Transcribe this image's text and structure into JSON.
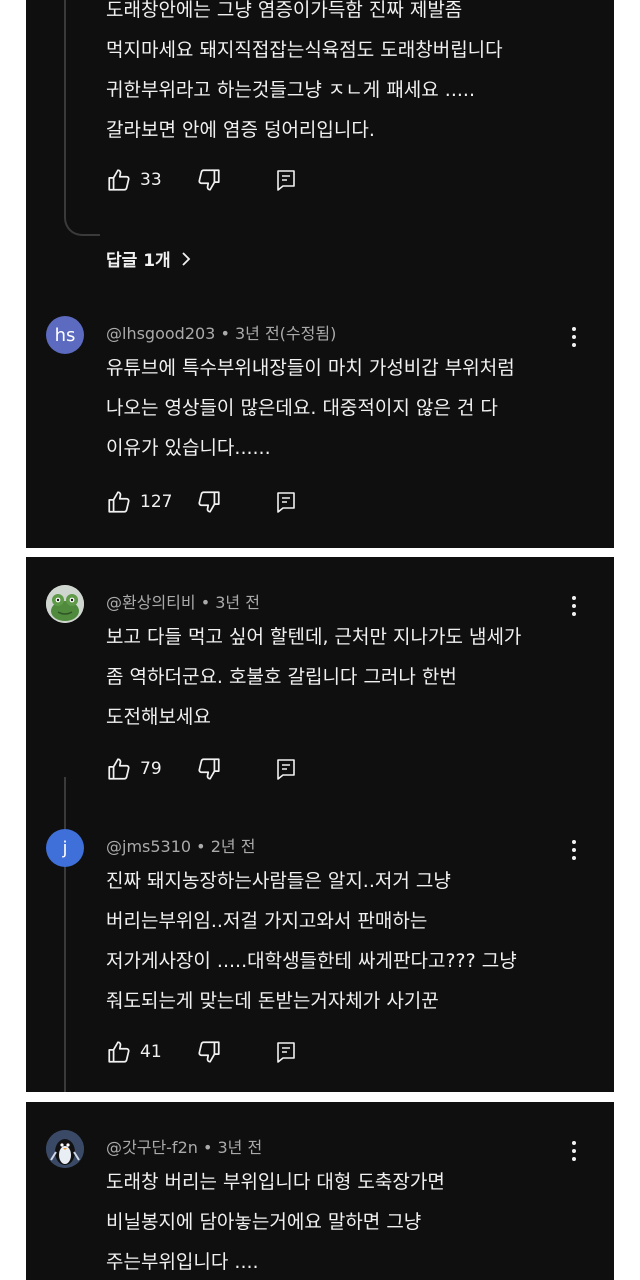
{
  "comments": [
    {
      "text_lines": [
        "도래창안에는 그냥 염증이가득함 진짜 제발좀",
        "먹지마세요 돼지직접잡는식육점도 도래창버립니다",
        "귀한부위라고 하는것들그냥 ㅈㄴ게 패세요 .....",
        "갈라보면 안에 염증 덩어리입니다."
      ],
      "likes": "33",
      "replies_label": "답글 1개"
    },
    {
      "avatar_initials": "hs",
      "avatar_color": "#5c6bc0",
      "author": "@lhsgood203",
      "time": "3년 전(수정됨)",
      "text_lines": [
        "유튜브에 특수부위내장들이 마치 가성비갑 부위처럼",
        "나오는 영상들이 많은데요.  대중적이지 않은 건 다",
        "이유가 있습니다......"
      ],
      "likes": "127"
    },
    {
      "avatar_icon": "frog-avatar-icon",
      "author": "@환상의티비",
      "time": "3년 전",
      "text_lines": [
        "보고 다들 먹고 싶어 할텐데,  근처만 지나가도 냄세가",
        "좀 역하더군요.  호불호 갈립니다 그러나 한번",
        "도전해보세요"
      ],
      "likes": "79"
    },
    {
      "avatar_initials": "j",
      "avatar_color": "#3f6fd9",
      "author": "@jms5310",
      "time": "2년 전",
      "text_lines": [
        "진짜 돼지농장하는사람들은 알지..저거 그냥",
        "버리는부위임..저걸 가지고와서 판매하는",
        "저가게사장이 .....대학생들한테 싸게판다고???  그냥",
        "줘도되는게 맞는데 돈받는거자체가 사기꾼"
      ],
      "likes": "41"
    },
    {
      "avatar_icon": "penguin-avatar-icon",
      "author": "@갓구단-f2n",
      "time": "3년 전",
      "text_lines": [
        "도래창 버리는 부위입니다 대형 도축장가면",
        "비닐봉지에 담아놓는거에요 말하면 그냥",
        "주는부위입니다 ...."
      ]
    }
  ],
  "meta_separator": " • "
}
